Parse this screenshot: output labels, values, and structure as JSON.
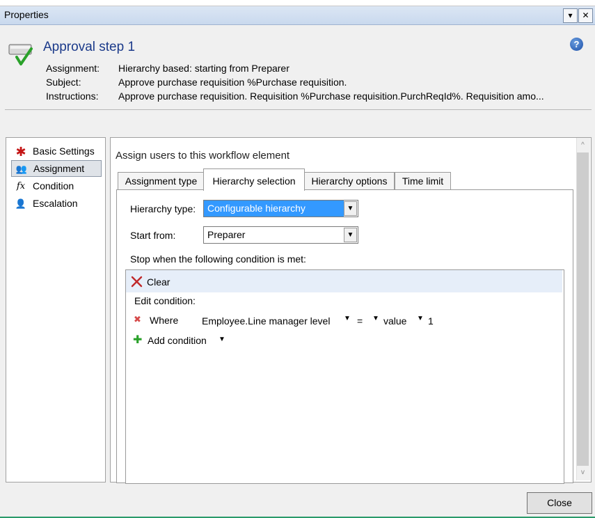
{
  "window": {
    "title": "Properties",
    "menu_glyph": "▾",
    "close_glyph": "✕"
  },
  "header": {
    "title": "Approval step 1",
    "help_glyph": "?",
    "rows": [
      {
        "label": "Assignment:",
        "value": "Hierarchy based: starting from Preparer"
      },
      {
        "label": "Subject:",
        "value": "Approve purchase requisition %Purchase requisition."
      },
      {
        "label": "Instructions:",
        "value": "Approve purchase requisition. Requisition %Purchase requisition.PurchReqId%. Requisition amo..."
      }
    ]
  },
  "nav": {
    "items": [
      {
        "label": "Basic Settings",
        "icon": "asterisk-icon",
        "glyph": "✱"
      },
      {
        "label": "Assignment",
        "icon": "users-icon",
        "glyph": "👥",
        "selected": true
      },
      {
        "label": "Condition",
        "icon": "function-icon",
        "glyph": "fx"
      },
      {
        "label": "Escalation",
        "icon": "escalation-icon",
        "glyph": "👤"
      }
    ]
  },
  "main": {
    "heading": "Assign users to this workflow element",
    "tabs": [
      {
        "label": "Assignment type"
      },
      {
        "label": "Hierarchy selection",
        "selected": true
      },
      {
        "label": "Hierarchy options"
      },
      {
        "label": "Time limit"
      }
    ],
    "hierarchy_type": {
      "label": "Hierarchy type:",
      "value": "Configurable hierarchy"
    },
    "start_from": {
      "label": "Start from:",
      "value": "Preparer"
    },
    "stop_label": "Stop when the following condition is met:",
    "condition": {
      "clear_label": "Clear",
      "edit_label": "Edit condition:",
      "where_label": "Where",
      "field": "Employee.Line manager level",
      "operator": "=",
      "value_type": "value",
      "value": "1",
      "add_label": "Add condition"
    }
  },
  "footer": {
    "close_label": "Close"
  },
  "scrollbar": {
    "up": "^",
    "down": "v"
  }
}
